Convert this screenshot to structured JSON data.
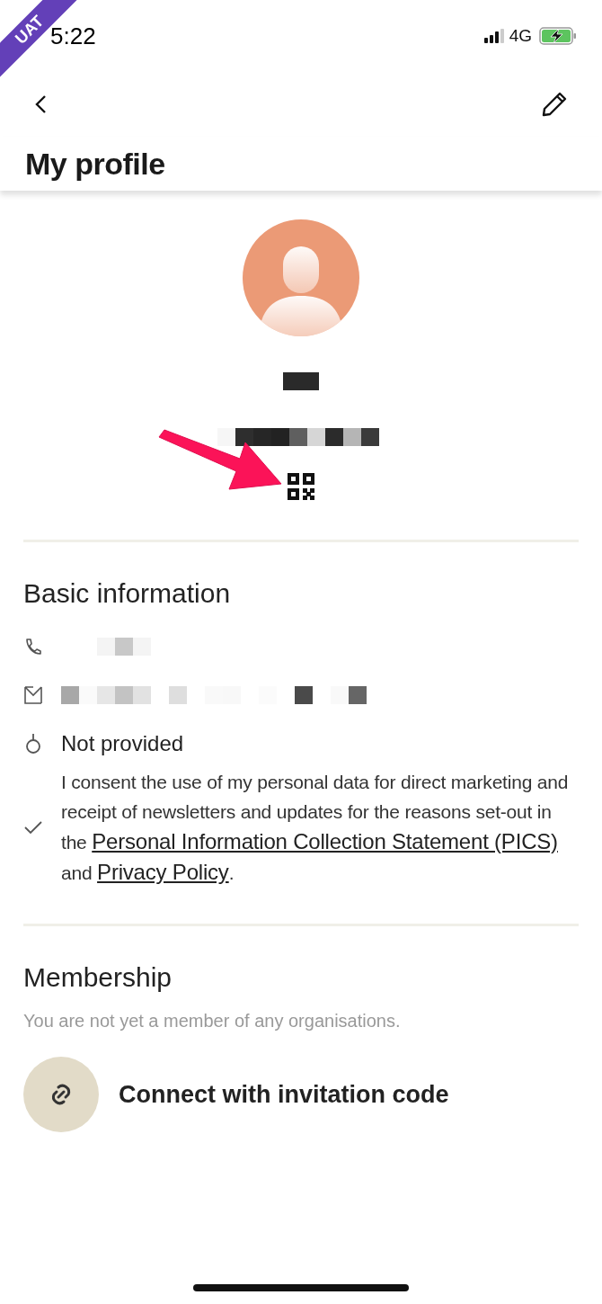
{
  "ribbon": "UAT",
  "status_bar": {
    "time": "5:22",
    "network": "4G"
  },
  "header": {
    "title": "My profile"
  },
  "basic_information": {
    "heading": "Basic information",
    "rows": [
      {
        "kind": "phone"
      },
      {
        "kind": "email"
      },
      {
        "kind": "gender",
        "value": "Not provided"
      }
    ],
    "consent": {
      "checked": true,
      "text": "I consent the use of my personal data for direct marketing and receipt of newsletters and updates for the reasons set-out in the",
      "link_1": "Personal Information Collection Statement (PICS)",
      "joiner": "and",
      "link_2": "Privacy Policy",
      "end": "."
    }
  },
  "membership": {
    "heading": "Membership",
    "note": "You are not yet a member of any organisations.",
    "action": "Connect with invitation code"
  }
}
